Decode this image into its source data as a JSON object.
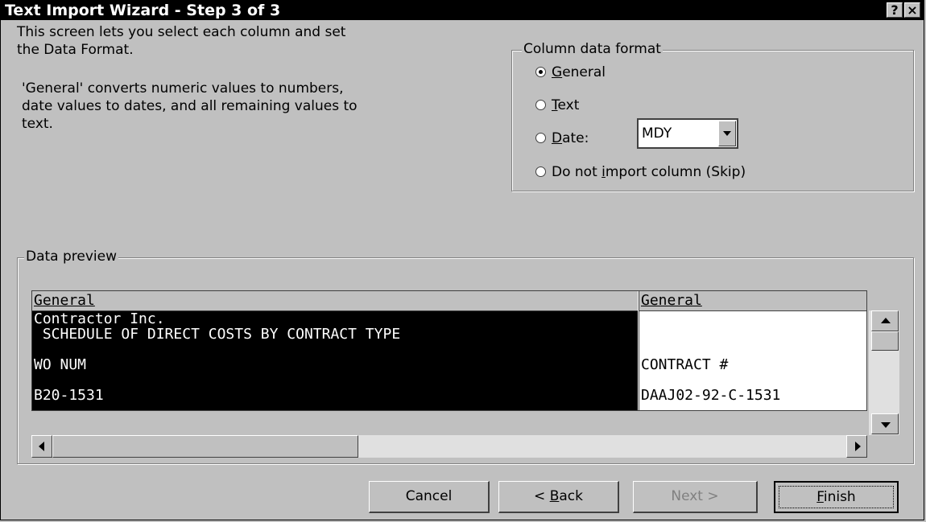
{
  "window": {
    "title": "Text Import Wizard - Step 3 of 3",
    "help_label": "?",
    "close_label": "×"
  },
  "description": {
    "line1": "This screen lets you select each column and set",
    "line2": "the Data Format.",
    "general1": "'General' converts numeric values to numbers,",
    "general2": "date values to dates, and all remaining values to",
    "general3": "text."
  },
  "column_format": {
    "legend": "Column data format",
    "options": [
      {
        "pre": "",
        "key": "G",
        "rest": "eneral",
        "checked": true
      },
      {
        "pre": "",
        "key": "T",
        "rest": "ext",
        "checked": false
      },
      {
        "pre": "",
        "key": "D",
        "rest": "ate:",
        "checked": false
      },
      {
        "pre": "Do not ",
        "key": "i",
        "rest": "mport column (Skip)",
        "checked": false
      }
    ],
    "date_value": "MDY"
  },
  "preview": {
    "legend": "Data preview",
    "columns": [
      {
        "header": "General",
        "rows": [
          "Contractor Inc.",
          " SCHEDULE OF DIRECT COSTS BY CONTRACT TYPE",
          "",
          "WO NUM",
          "",
          "B20-1531"
        ]
      },
      {
        "header": "General",
        "rows": [
          "",
          "",
          "",
          "CONTRACT #",
          "",
          "DAAJ02-92-C-1531"
        ]
      }
    ]
  },
  "buttons": {
    "cancel": "Cancel",
    "back_pre": "< ",
    "back_key": "B",
    "back_rest": "ack",
    "next": "Next >",
    "finish_key": "F",
    "finish_rest": "inish"
  }
}
